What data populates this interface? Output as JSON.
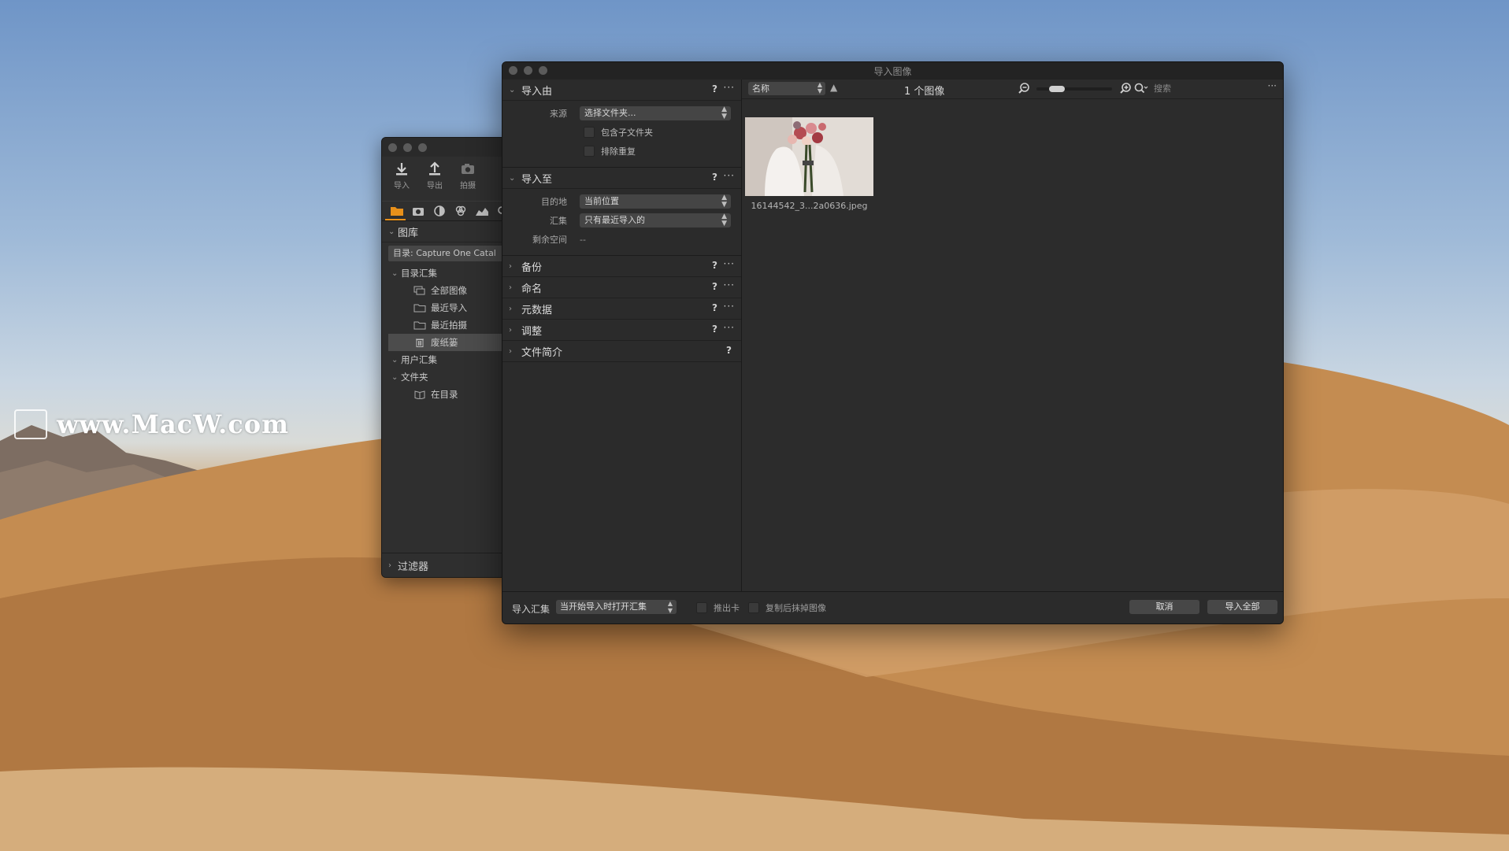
{
  "watermark": "www.MacW.com",
  "library": {
    "toolbar": [
      {
        "label": "导入",
        "icon": "import-icon"
      },
      {
        "label": "导出",
        "icon": "export-icon"
      },
      {
        "label": "拍摄",
        "icon": "camera-icon"
      }
    ],
    "section_title": "图库",
    "catalog": "目录: Capture One Catal",
    "groups": {
      "catalog_collections": "目录汇集",
      "user_collections": "用户汇集",
      "folders": "文件夹"
    },
    "items": {
      "all_images": "全部图像",
      "recent_imports": "最近导入",
      "recent_captures": "最近拍摄",
      "trash": "废纸篓",
      "in_catalog": "在目录"
    },
    "filter": "过滤器"
  },
  "import": {
    "title": "导入图像",
    "sections": {
      "import_from": "导入由",
      "import_to": "导入至",
      "backup": "备份",
      "naming": "命名",
      "metadata": "元数据",
      "adjust": "调整",
      "file_info": "文件简介"
    },
    "qmark": "?",
    "dots": "···",
    "source_label": "来源",
    "source_value": "选择文件夹...",
    "include_subfolders": "包含子文件夹",
    "exclude_duplicates": "排除重复",
    "dest_label": "目的地",
    "dest_value": "当前位置",
    "collection_label": "汇集",
    "collection_value": "只有最近导入的",
    "space_label": "剩余空间",
    "space_value": "--",
    "sort_value": "名称",
    "image_count": "1 个图像",
    "search_placeholder": "搜索",
    "thumb_caption": "16144542_3...2a0636.jpeg",
    "bottom": {
      "collection_label": "导入汇集",
      "collection_value": "当开始导入时打开汇集",
      "eject": "推出卡",
      "erase": "复制后抹掉图像",
      "cancel": "取消",
      "import_all": "导入全部"
    }
  }
}
